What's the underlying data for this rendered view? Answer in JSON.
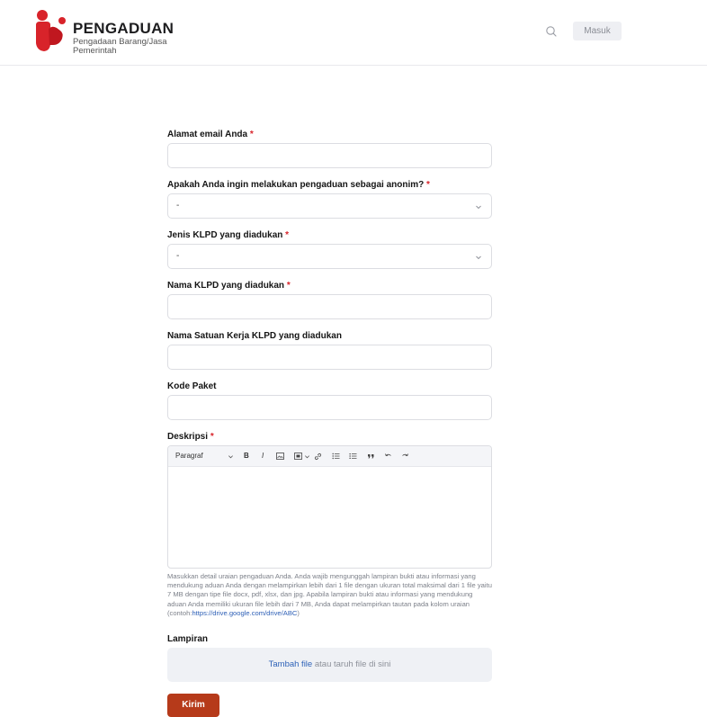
{
  "header": {
    "brand_title": "PENGADUAN",
    "brand_sub1": "Pengadaan Barang/Jasa",
    "brand_sub2": "Pemerintah",
    "login_label": "Masuk",
    "accent_color": "#d8232a"
  },
  "form": {
    "email": {
      "label": "Alamat email Anda",
      "required": "*",
      "value": ""
    },
    "anonymous": {
      "label": "Apakah Anda ingin melakukan pengaduan sebagai anonim?",
      "required": "*",
      "selected": "-"
    },
    "klpd_type": {
      "label": "Jenis KLPD yang diadukan",
      "required": "*",
      "selected": "-"
    },
    "klpd_name": {
      "label": "Nama KLPD yang diadukan",
      "required": "*",
      "value": ""
    },
    "work_unit": {
      "label": "Nama Satuan Kerja KLPD yang diadukan",
      "value": ""
    },
    "package_code": {
      "label": "Kode Paket",
      "value": ""
    },
    "description": {
      "label": "Deskripsi",
      "required": "*",
      "toolbar": {
        "paragraph": "Paragraf",
        "bold": "B",
        "italic": "I"
      },
      "help_text": "Masukkan detail uraian pengaduan Anda. Anda wajib mengunggah lampiran bukti atau informasi yang mendukung aduan Anda dengan melampirkan lebih dari 1 file dengan ukuran total maksimal dari 1 file yaitu 7 MB dengan tipe file docx, pdf, xlsx, dan jpg. Apabila lampiran bukti atau informasi yang mendukung aduan Anda memiliki ukuran file lebih dari 7 MB, Anda dapat melampirkan tautan pada kolom uraian (contoh:",
      "help_link": "https://drive.google.com/drive/ABC",
      "help_end": ")"
    },
    "attachment": {
      "label": "Lampiran",
      "add_file": "Tambah file",
      "drop_text": " atau taruh file di sini"
    },
    "submit_label": "Kirim",
    "submit_color": "#b63a1a"
  }
}
